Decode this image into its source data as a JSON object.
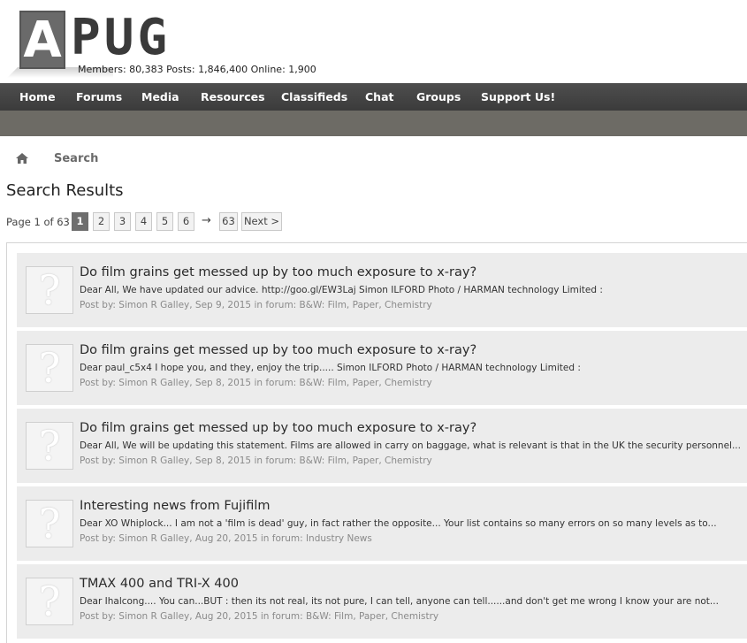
{
  "site": {
    "logo_letter": "A",
    "logo_rest": "PUG",
    "stats": "Members: 80,383 Posts: 1,846,400 Online: 1,900"
  },
  "nav": {
    "items": [
      "Home",
      "Forums",
      "Media",
      "Resources",
      "Classifieds",
      "Chat",
      "Groups",
      "Support Us!"
    ]
  },
  "breadcrumb": {
    "home_icon": "home-icon",
    "current": "Search"
  },
  "page": {
    "title": "Search Results"
  },
  "pager": {
    "label": "Page 1 of 63",
    "pages": [
      "1",
      "2",
      "3",
      "4",
      "5",
      "6"
    ],
    "current": "1",
    "skip_arrow": "→",
    "last": "63",
    "next": "Next >"
  },
  "results": [
    {
      "title": "Do film grains get messed up by too much exposure to x-ray?",
      "snippet": "Dear All, We have updated our advice. http://goo.gl/EW3Laj Simon ILFORD Photo / HARMAN technology Limited :",
      "meta": "Post by: Simon R Galley, Sep 9, 2015 in forum: B&W: Film, Paper, Chemistry"
    },
    {
      "title": "Do film grains get messed up by too much exposure to x-ray?",
      "snippet": "Dear paul_c5x4 I hope you, and they, enjoy the trip..... Simon ILFORD Photo / HARMAN technology Limited :",
      "meta": "Post by: Simon R Galley, Sep 8, 2015 in forum: B&W: Film, Paper, Chemistry"
    },
    {
      "title": "Do film grains get messed up by too much exposure to x-ray?",
      "snippet": "Dear All, We will be updating this statement. Films are allowed in carry on baggage, what is relevant is that in the UK the security personnel...",
      "meta": "Post by: Simon R Galley, Sep 8, 2015 in forum: B&W: Film, Paper, Chemistry"
    },
    {
      "title": "Interesting news from Fujifilm",
      "snippet": "Dear XO Whiplock... I am not a 'film is dead' guy, in fact rather the opposite... Your list contains so many errors on so many levels as to...",
      "meta": "Post by: Simon R Galley, Aug 20, 2015 in forum: Industry News"
    },
    {
      "title": "TMAX 400 and TRI-X 400",
      "snippet": "Dear Ihalcong.... You can...BUT : then its not real, its not pure, I can tell, anyone can tell......and don't get me wrong I know your are not...",
      "meta": "Post by: Simon R Galley, Aug 20, 2015 in forum: B&W: Film, Paper, Chemistry"
    }
  ],
  "colors": {
    "nav_bg": "#444444",
    "subnav_bg": "#6d6b65",
    "result_bg": "#ececec",
    "current_page_bg": "#6e6e6e"
  }
}
